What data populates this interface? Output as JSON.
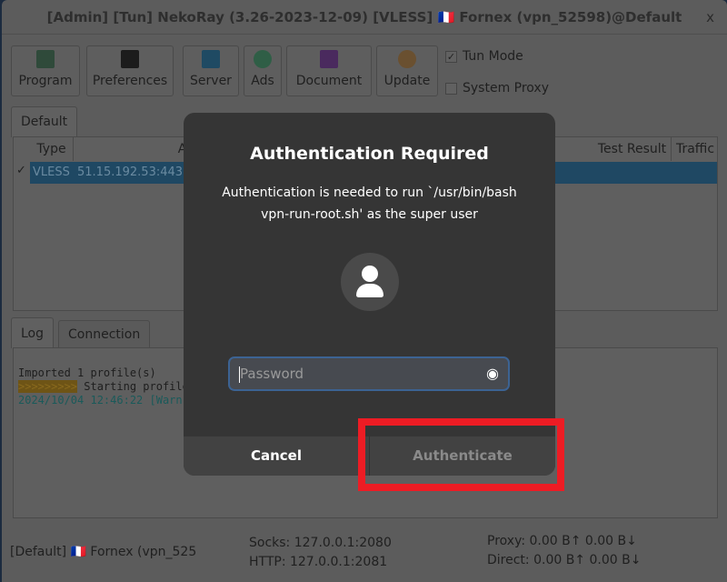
{
  "window": {
    "title": "[Admin] [Tun] NekoRay (3.26-2023-12-09) [VLESS] 🇫🇷 Fornex (vpn_52598)@Default",
    "close": "x"
  },
  "toolbar": {
    "buttons": [
      {
        "label": "Program",
        "icon": "program-icon"
      },
      {
        "label": "Preferences",
        "icon": "preferences-icon"
      },
      {
        "label": "Server",
        "icon": "server-icon"
      },
      {
        "label": "Ads",
        "icon": "globe-icon"
      },
      {
        "label": "Document",
        "icon": "document-icon"
      },
      {
        "label": "Update",
        "icon": "update-icon"
      }
    ],
    "tun_mode": {
      "label": "Tun Mode",
      "checked": true
    },
    "system_proxy": {
      "label": "System Proxy",
      "checked": false
    }
  },
  "group_tab": "Default",
  "table": {
    "headers": [
      "Type",
      "A",
      "Test Result",
      "Traffic"
    ],
    "rows": [
      {
        "check": "✓",
        "type": "VLESS",
        "address": "51.15.192.53:443"
      }
    ]
  },
  "log_tabs": [
    "Log",
    "Connection"
  ],
  "log": [
    "Imported 1 profile(s)",
    ">>>>>>>>>",
    " Starting profile",
    "2024/10/04 12:46:22 [Warn"
  ],
  "status": {
    "profile": "[Default] 🇫🇷 Fornex (vpn_525",
    "socks": "Socks: 127.0.0.1:2080",
    "http": "HTTP: 127.0.0.1:2081",
    "proxy": "Proxy: 0.00 B↑ 0.00 B↓",
    "direct": "Direct: 0.00 B↑ 0.00 B↓"
  },
  "dialog": {
    "title": "Authentication Required",
    "message": "Authentication is needed to run `/usr/bin/bash vpn-run-root.sh' as the super user",
    "password_placeholder": "Password",
    "cancel": "Cancel",
    "authenticate": "Authenticate"
  },
  "colors": {
    "highlight": "#ed1c24",
    "dialog_bg": "#353535",
    "focus": "#3c6393"
  }
}
